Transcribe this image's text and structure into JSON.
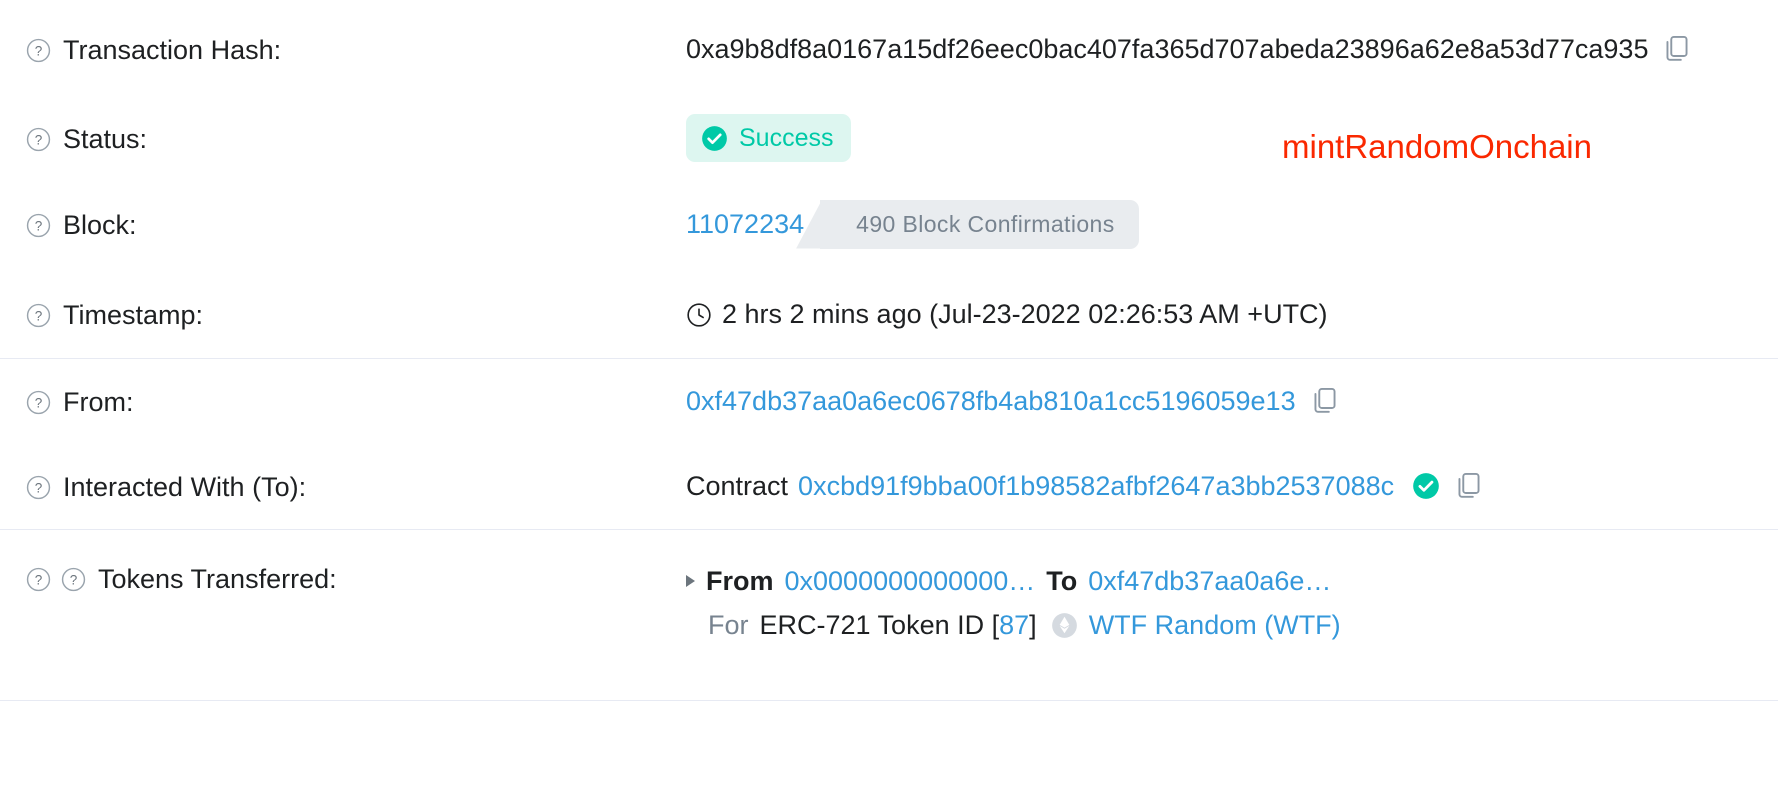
{
  "colors": {
    "link": "#3498db",
    "success_text": "#00c9a7",
    "success_bg": "#ddf6f0",
    "annotation": "#fa2800",
    "muted": "#77838f",
    "chip_bg": "#e9ecef",
    "divider": "#e7eaf3",
    "text": "#1e2022"
  },
  "rows": {
    "tx_hash": {
      "label": "Transaction Hash:",
      "value": "0xa9b8df8a0167a15df26eec0bac407fa365d707abeda23896a62e8a53d77ca935",
      "copy_icon": "copy-icon",
      "help_icon": "help-circle-icon"
    },
    "status": {
      "label": "Status:",
      "badge_text": "Success",
      "badge_icon": "check-circle-icon",
      "help_icon": "help-circle-icon"
    },
    "block": {
      "label": "Block:",
      "number": "11072234",
      "confirmations": "490 Block Confirmations",
      "help_icon": "help-circle-icon"
    },
    "timestamp": {
      "label": "Timestamp:",
      "icon": "clock-icon",
      "value": "2 hrs 2 mins ago (Jul-23-2022 02:26:53 AM +UTC)",
      "help_icon": "help-circle-icon"
    },
    "from": {
      "label": "From:",
      "address": "0xf47db37aa0a6ec0678fb4ab810a1cc5196059e13",
      "copy_icon": "copy-icon",
      "help_icon": "help-circle-icon"
    },
    "interacted_with": {
      "label": "Interacted With (To):",
      "prefix": "Contract",
      "address": "0xcbd91f9bba00f1b98582afbf2647a3bb2537088c",
      "verified_icon": "verified-check-icon",
      "copy_icon": "copy-icon",
      "help_icon": "help-circle-icon"
    },
    "tokens_transferred": {
      "label": "Tokens Transferred:",
      "help_icon_1": "help-circle-icon",
      "help_icon_2": "help-circle-icon",
      "expand_icon": "caret-right-icon",
      "from_word": "From",
      "from_address": "0x0000000000000…",
      "to_word": "To",
      "to_address": "0xf47db37aa0a6e…",
      "for_word": "For",
      "token_standard": "ERC-721 Token ID [",
      "token_id": "87",
      "token_id_close": "]",
      "token_icon": "ethereum-diamond-icon",
      "token_name": "WTF Random (WTF)"
    }
  },
  "annotation": {
    "text": "mintRandomOnchain"
  }
}
